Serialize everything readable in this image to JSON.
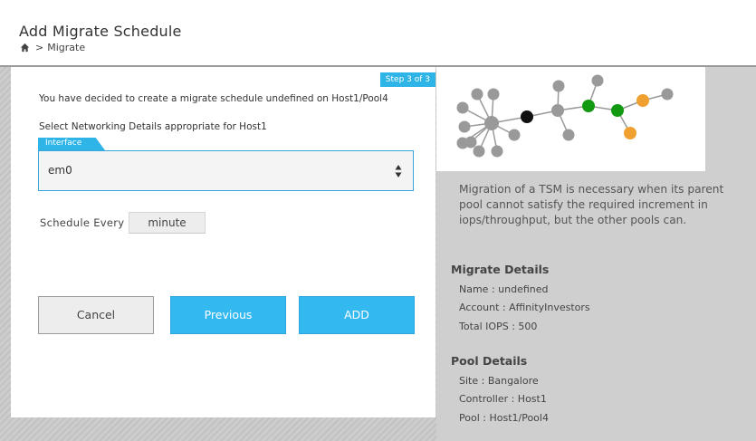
{
  "header": {
    "title": "Add Migrate Schedule",
    "breadcrumb_sep": ">",
    "breadcrumb_current": "Migrate"
  },
  "wizard": {
    "step_label": "Step 3 of 3",
    "intro_text": "You have decided to create a migrate schedule undefined on Host1/Pool4",
    "networking_label": "Select Networking Details appropriate for Host1",
    "interface_tab": "Interface",
    "interface_value": "em0",
    "schedule_label": "Schedule Every",
    "schedule_value": "minute"
  },
  "buttons": {
    "cancel": "Cancel",
    "previous": "Previous",
    "add": "ADD"
  },
  "info": {
    "description": "Migration of a TSM is necessary when its parent pool cannot satisfy the required increment in iops/throughput, but the other pools can.",
    "migrate_title": "Migrate Details",
    "migrate_name": "Name : undefined",
    "migrate_account": "Account : AffinityInvestors",
    "migrate_iops": "Total IOPS : 500",
    "pool_title": "Pool Details",
    "pool_site": "Site : Bangalore",
    "pool_controller": "Controller : Host1",
    "pool_pool": "Pool : Host1/Pool4"
  },
  "colors": {
    "accent": "#33b8f0",
    "node_gray": "#999999",
    "node_black": "#111111",
    "node_green": "#119911",
    "node_orange": "#f0a030"
  },
  "icons": {
    "home": "home-icon",
    "select_arrows": "sort-arrows-icon"
  }
}
